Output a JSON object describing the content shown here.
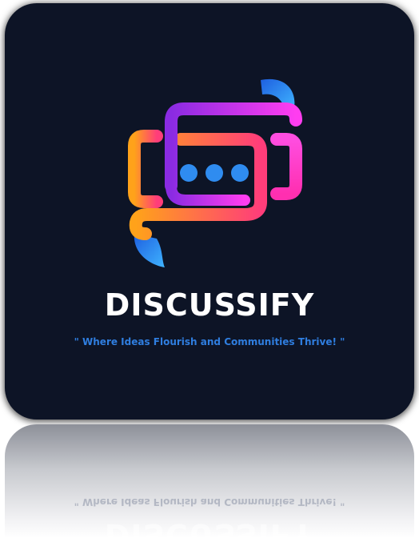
{
  "brand": {
    "name": "DISCUSSIFY",
    "tagline": "\" Where Ideas Flourish and Communities Thrive! \""
  },
  "colors": {
    "background": "#0d1426",
    "brand_text": "#ffffff",
    "tagline_text": "#2f7ee0",
    "orange": "#ff7a1a",
    "magenta": "#e233f0",
    "purple": "#8a2be2",
    "blue": "#2f8cf0"
  },
  "logo": {
    "icon": "chat-bubbles-icon",
    "dots": 3
  }
}
